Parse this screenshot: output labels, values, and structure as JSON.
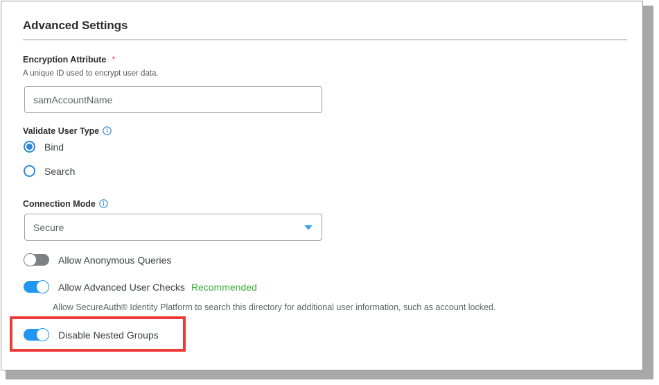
{
  "card": {
    "title": "Advanced Settings"
  },
  "fields": {
    "encryption_attribute": {
      "label": "Encryption Attribute",
      "required_marker": "*",
      "help": "A unique ID used to encrypt user data.",
      "value": "samAccountName",
      "placeholder": "samAccountName"
    },
    "validate_user_type": {
      "label": "Validate User Type",
      "info_icon": "info-circle-icon",
      "options": [
        {
          "label": "Bind",
          "selected": true
        },
        {
          "label": "Search",
          "selected": false
        }
      ]
    },
    "connection_mode": {
      "label": "Connection Mode",
      "info_icon": "info-circle-icon",
      "value": "Secure",
      "caret_icon": "chevron-down-icon",
      "options": [
        "Secure"
      ]
    }
  },
  "toggles": [
    {
      "name": "allow-anonymous-queries",
      "label": "Allow Anonymous Queries",
      "state": "off",
      "badge": "",
      "help": ""
    },
    {
      "name": "allow-advanced-user-checks",
      "label": "Allow Advanced User Checks",
      "state": "on",
      "badge": "Recommended",
      "help": "Allow SecureAuth® Identity Platform to search this directory for additional user information, such as account locked."
    },
    {
      "name": "disable-nested-groups",
      "label": "Disable Nested Groups",
      "state": "on",
      "badge": "",
      "help": ""
    }
  ],
  "annotation": {
    "type": "red-highlight-rectangle",
    "targets": "disable-nested-groups"
  },
  "colors": {
    "accent_blue": "#2196f3",
    "radio_blue": "#2f87d6",
    "recommended_green": "#3fae3f",
    "required_red": "#e8493f",
    "highlight_red": "#ef3b36",
    "toggle_off_gray": "#7d8084",
    "text_dark": "#3c4043",
    "border_gray": "#9aa0a6"
  }
}
